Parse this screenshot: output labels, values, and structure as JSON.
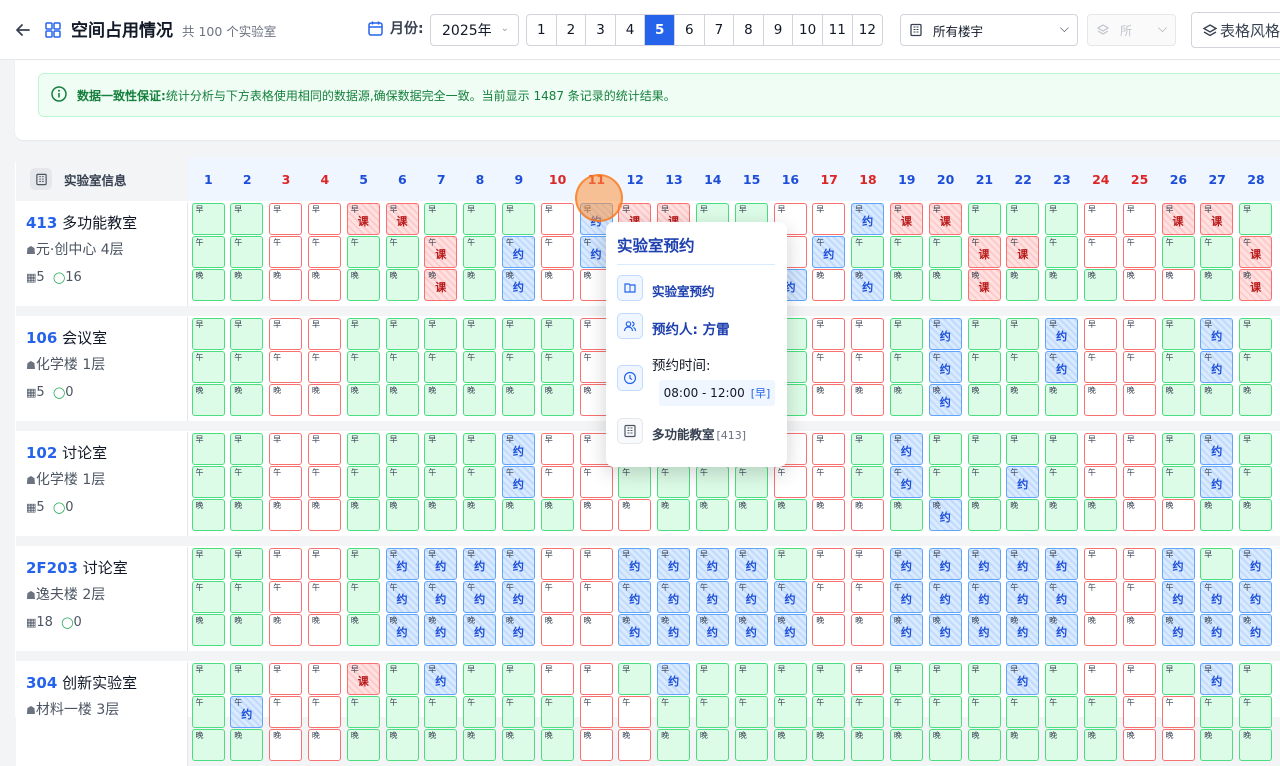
{
  "header": {
    "back_icon": "arrow-left-icon",
    "grid_icon": "grid-icon",
    "title": "空间占用情况",
    "count": "共 100 个实验室",
    "month_label": "月份:",
    "year": "2025年",
    "months": [
      "1",
      "2",
      "3",
      "4",
      "5",
      "6",
      "7",
      "8",
      "9",
      "10",
      "11",
      "12"
    ],
    "active_month": "5",
    "building_placeholder": "所有楼宇",
    "floor_placeholder": "所",
    "style_button": "表格风格"
  },
  "notice": {
    "title": "数据一致性保证:",
    "text": "统计分析与下方表格使用相同的数据源,确保数据完全一致。当前显示 1487 条记录的统计结果。"
  },
  "table": {
    "header_label": "实验室信息",
    "days": [
      "1",
      "2",
      "3",
      "4",
      "5",
      "6",
      "7",
      "8",
      "9",
      "10",
      "11",
      "12",
      "13",
      "14",
      "15",
      "16",
      "17",
      "18",
      "19",
      "20",
      "21",
      "22",
      "23",
      "24",
      "25",
      "26",
      "27",
      "28"
    ],
    "weekend_days": [
      "3",
      "4",
      "10",
      "11",
      "17",
      "18",
      "24",
      "25"
    ],
    "slot_labels": [
      "早",
      "午",
      "晚"
    ],
    "status_labels": {
      "reserved": "约",
      "class": "课"
    },
    "rooms": [
      {
        "code": "413",
        "name": "多功能教室",
        "building": "元·创中心 4层",
        "capacity": "5",
        "usage": "16"
      },
      {
        "code": "106",
        "name": "会议室",
        "building": "化学楼 1层",
        "capacity": "5",
        "usage": "0"
      },
      {
        "code": "102",
        "name": "讨论室",
        "building": "化学楼 1层",
        "capacity": "5",
        "usage": "0"
      },
      {
        "code": "2F203",
        "name": "讨论室",
        "building": "逸夫楼 2层",
        "capacity": "18",
        "usage": "0"
      },
      {
        "code": "304",
        "name": "创新实验室",
        "building": "材料一楼 3层",
        "capacity": "",
        "usage": ""
      }
    ]
  },
  "tooltip": {
    "title": "实验室预约",
    "type_label": "实验室预约",
    "person": "预约人: 方雷",
    "time_label": "预约时间:",
    "time": "08:00 - 12:00",
    "time_tag": "[早]",
    "room_name": "多功能教室",
    "room_code": "[413]"
  }
}
